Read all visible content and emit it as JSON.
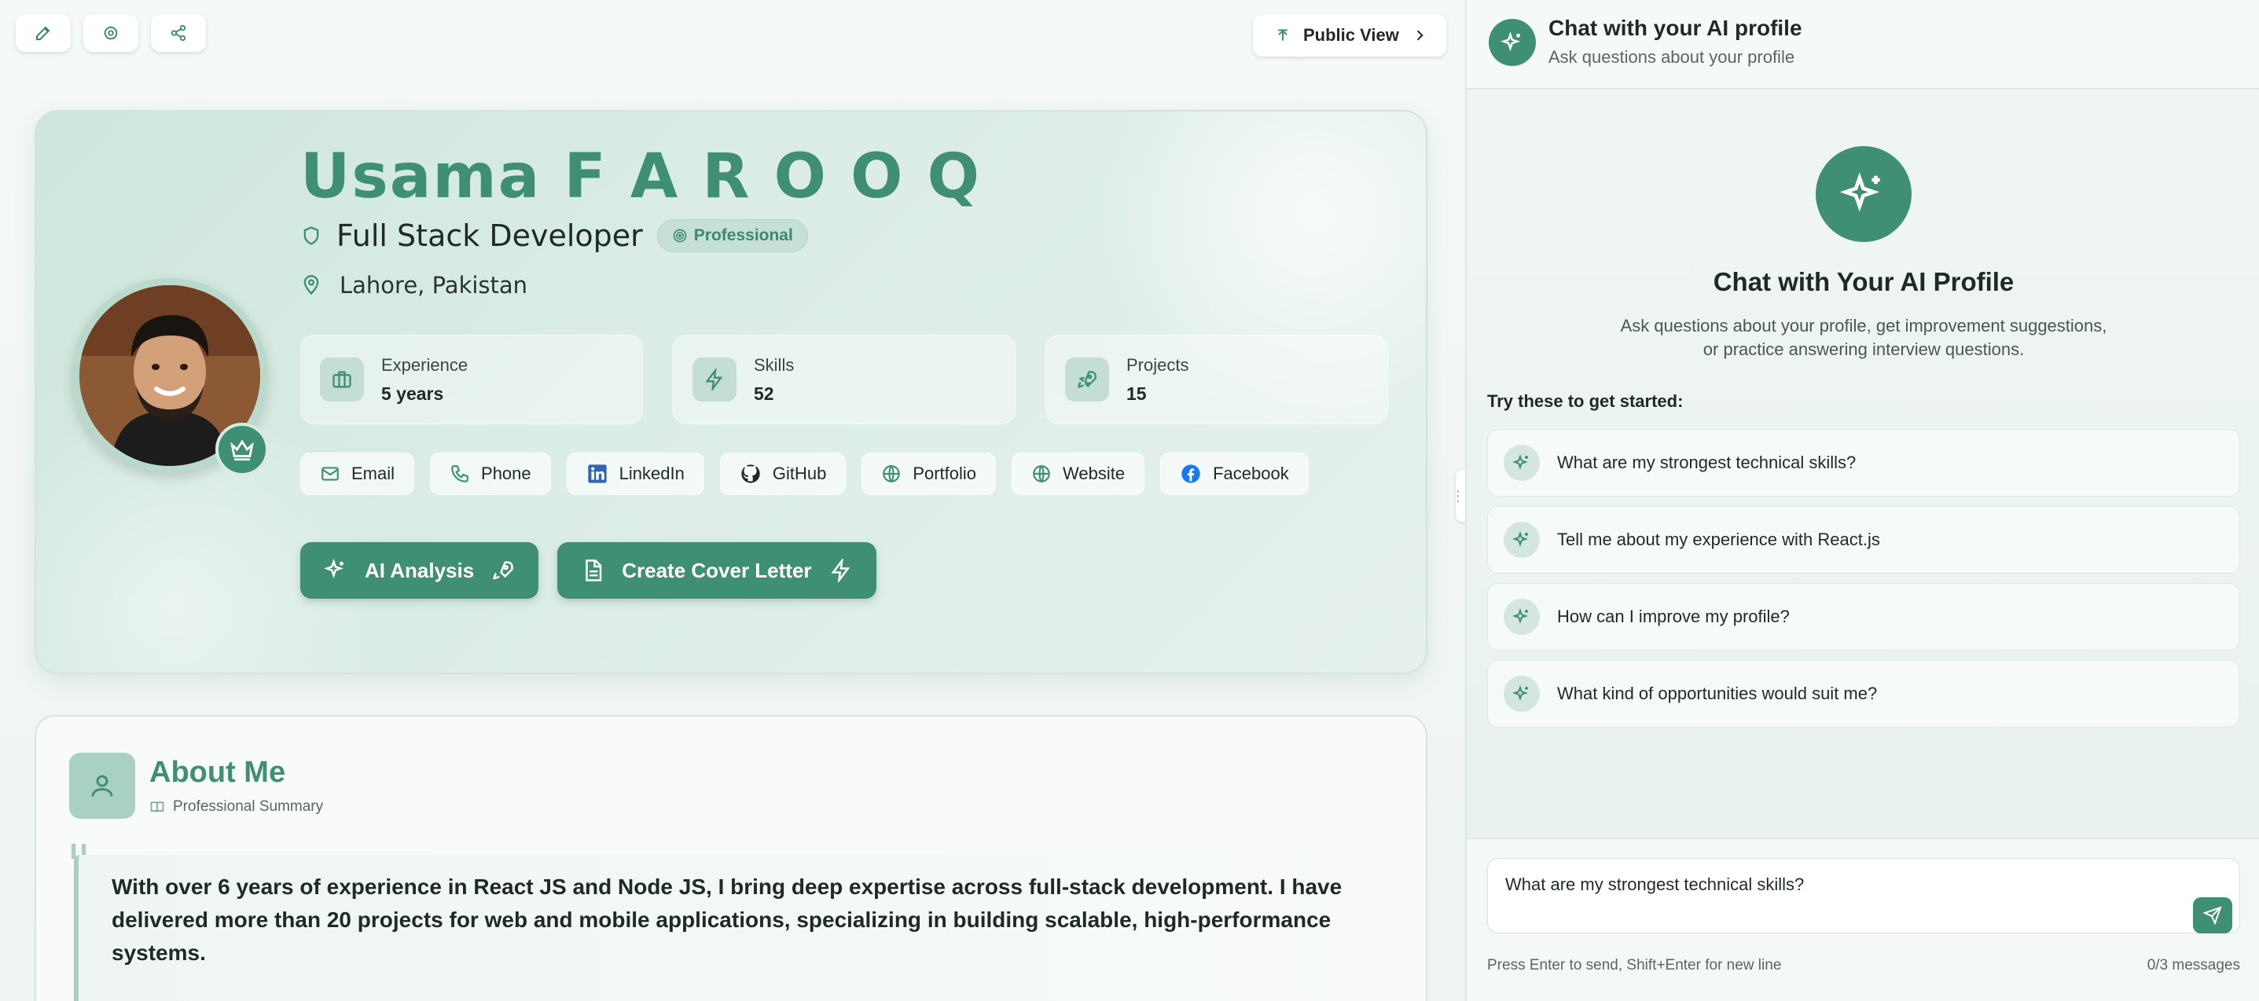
{
  "toolbar": {
    "public_view_label": "Public View"
  },
  "profile": {
    "first_name": "Usama",
    "last_name": "F A R O O Q",
    "role": "Full Stack Developer",
    "badge": "Professional",
    "location": "Lahore, Pakistan",
    "stats": [
      {
        "label": "Experience",
        "value": "5 years",
        "icon": "briefcase-icon"
      },
      {
        "label": "Skills",
        "value": "52",
        "icon": "bolt-icon"
      },
      {
        "label": "Projects",
        "value": "15",
        "icon": "rocket-icon"
      }
    ],
    "contacts": [
      {
        "label": "Email",
        "icon": "mail-icon"
      },
      {
        "label": "Phone",
        "icon": "phone-icon"
      },
      {
        "label": "LinkedIn",
        "icon": "linkedin-icon"
      },
      {
        "label": "GitHub",
        "icon": "github-icon"
      },
      {
        "label": "Portfolio",
        "icon": "globe-icon"
      },
      {
        "label": "Website",
        "icon": "globe-icon"
      },
      {
        "label": "Facebook",
        "icon": "facebook-icon"
      }
    ],
    "actions": {
      "ai_analysis": "AI Analysis",
      "cover_letter": "Create Cover Letter"
    }
  },
  "about": {
    "title": "About Me",
    "subtitle": "Professional Summary",
    "text": "With over 6 years of experience in React JS and Node JS, I bring deep expertise across full-stack development. I have delivered more than 20 projects for web and mobile applications, specializing in building scalable, high-performance systems."
  },
  "chat": {
    "header_title": "Chat with your AI profile",
    "header_subtitle": "Ask questions about your profile",
    "hero_title": "Chat with Your AI Profile",
    "hero_desc_line1": "Ask questions about your profile, get improvement suggestions,",
    "hero_desc_line2": "or practice answering interview questions.",
    "try_label": "Try these to get started:",
    "suggestions": [
      "What are my strongest technical skills?",
      "Tell me about my experience with React.js",
      "How can I improve my profile?",
      "What kind of opportunities would suit me?"
    ],
    "input_value": "What are my strongest technical skills?",
    "hint": "Press Enter to send, Shift+Enter for new line",
    "counter": "0/3 messages"
  },
  "colors": {
    "accent": "#3f8f75",
    "accent_light": "#c7e0d5"
  }
}
